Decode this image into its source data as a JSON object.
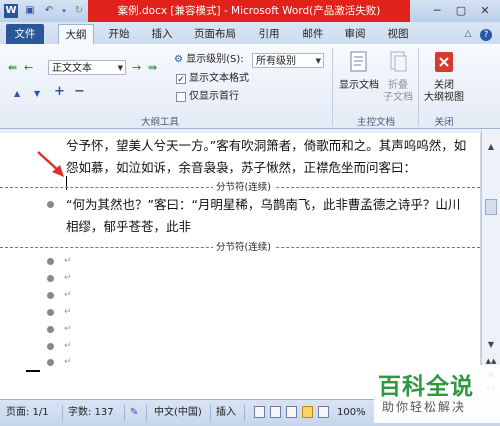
{
  "window": {
    "title": "案例.docx [兼容模式] - Microsoft Word(产品激活失败)",
    "controls": {
      "minimize": "─",
      "restore": "▢",
      "close": "✕"
    }
  },
  "tabs": [
    {
      "label": "文件"
    },
    {
      "label": "大纲"
    },
    {
      "label": "开始"
    },
    {
      "label": "插入"
    },
    {
      "label": "页面布局"
    },
    {
      "label": "引用"
    },
    {
      "label": "邮件"
    },
    {
      "label": "审阅"
    },
    {
      "label": "视图"
    }
  ],
  "ribbon": {
    "outline_tools": {
      "level_select": "正文文本",
      "show_level_label": "显示级别(S):",
      "show_level_value": "所有级别",
      "show_text_format_label": "显示文本格式",
      "show_text_format_checked": true,
      "first_line_only_label": "仅显示首行",
      "first_line_only_checked": false,
      "group_label": "大纲工具"
    },
    "master_doc": {
      "show_document_label": "显示文档",
      "collapse_subdocs_label_1": "折叠",
      "collapse_subdocs_label_2": "子文档",
      "group_label": "主控文档"
    },
    "close": {
      "button_label_1": "关闭",
      "button_label_2": "大纲视图",
      "group_label": "关闭"
    }
  },
  "document": {
    "line1": "兮予怀，望美人兮天一方。”客有吹洞箫者，倚歌而和之。其声呜呜然，如",
    "line2": "怨如慕，如泣如诉，余音袅袅，苏子愀然，正襟危坐而问客曰：",
    "section_break": "分节符(连续)",
    "line3": "“何为其然也？”客曰：“月明星稀，乌鹊南飞，此非曹孟德之诗乎？山川",
    "line4": "相缪，郁乎苍苍，此非",
    "para_mark": "↵"
  },
  "status": {
    "page": "页面: 1/1",
    "words": "字数: 137",
    "language": "中文(中国)",
    "insert_mode": "插入",
    "zoom": "100%"
  },
  "watermark": {
    "logo_text": "百科全说",
    "slogan": "助你轻松解决"
  },
  "colors": {
    "title_bar": "#e0221b",
    "file_tab": "#2b5797",
    "watermark_green": "#2e9a3f"
  }
}
